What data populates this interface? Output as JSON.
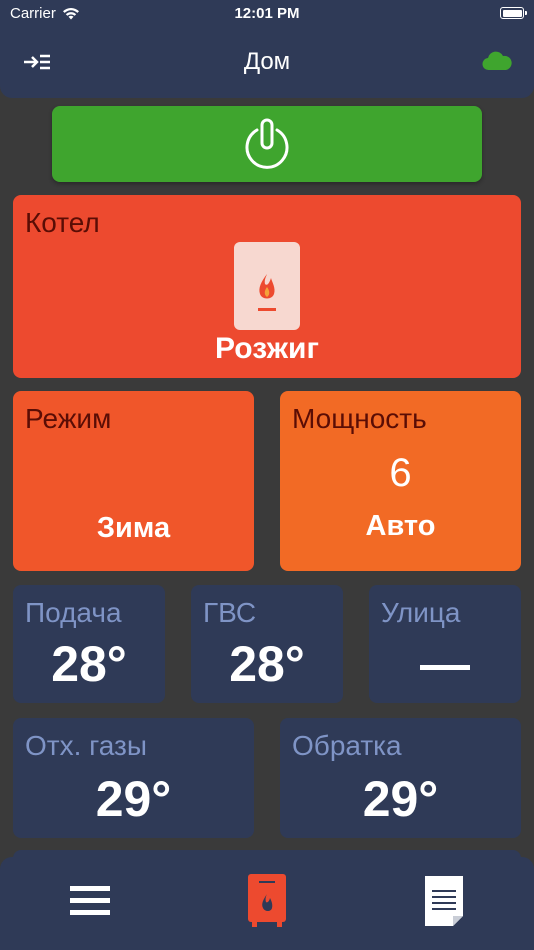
{
  "status_bar": {
    "carrier": "Carrier",
    "time": "12:01 PM"
  },
  "nav": {
    "title": "Дом",
    "left_icon": "menu-arrow-icon",
    "right_icon": "cloud-icon"
  },
  "power_button": {
    "icon": "power-icon",
    "color": "#3fa52e"
  },
  "boiler": {
    "title": "Котел",
    "state": "Розжиг",
    "icon": "boiler-flame-icon",
    "color": "#ed4a2f"
  },
  "mode": {
    "title": "Режим",
    "value": "Зима",
    "color": "#f0562a"
  },
  "power_level": {
    "title": "Мощность",
    "level": "6",
    "mode": "Авто",
    "color": "#f26a25"
  },
  "sensors": [
    {
      "title": "Подача",
      "value": "28°"
    },
    {
      "title": "ГВС",
      "value": "28°"
    },
    {
      "title": "Улица",
      "value": "—"
    },
    {
      "title": "Отх. газы",
      "value": "29°"
    },
    {
      "title": "Обратка",
      "value": "29°"
    }
  ],
  "tab_bar": {
    "tabs": [
      "menu-icon",
      "boiler-icon",
      "document-icon"
    ]
  },
  "colors": {
    "panel": "#2f3a57",
    "background": "#3a3a3a",
    "sensor_label": "#7f94c6"
  }
}
